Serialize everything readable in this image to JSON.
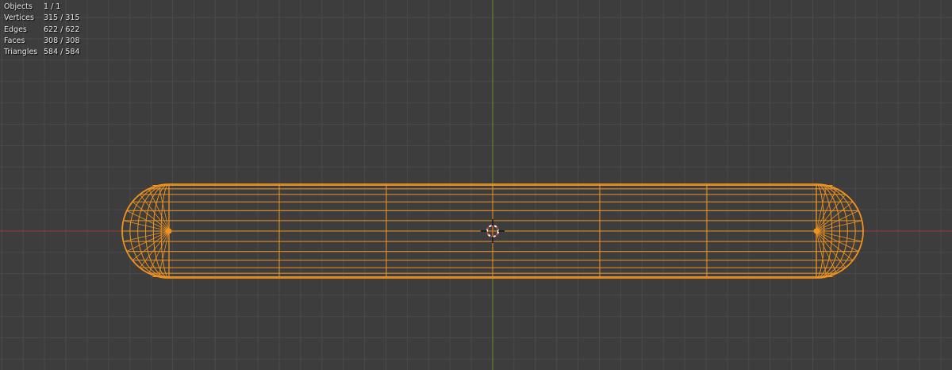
{
  "viewport": {
    "background_color": "#3d3d3d",
    "x_axis_color": "#9a3b3b",
    "y_axis_color": "#6d8a2e",
    "wire_color": "#f0931e",
    "cursor_icon": "3d-cursor-icon"
  },
  "stats": {
    "rows": [
      {
        "label": "Objects",
        "value": "1 / 1"
      },
      {
        "label": "Vertices",
        "value": "315 / 315"
      },
      {
        "label": "Edges",
        "value": "622 / 622"
      },
      {
        "label": "Faces",
        "value": "308 / 308"
      },
      {
        "label": "Triangles",
        "value": "584 / 584"
      }
    ]
  }
}
